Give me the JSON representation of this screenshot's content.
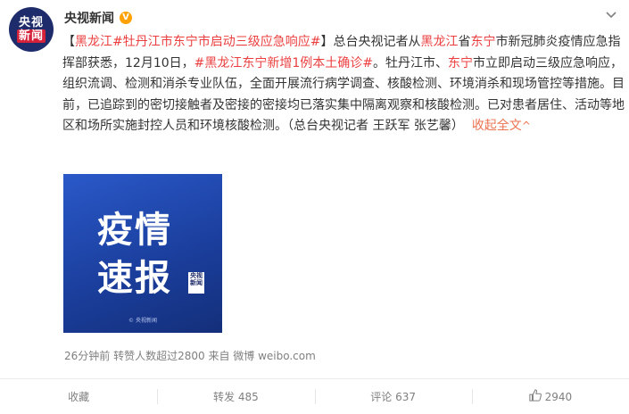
{
  "header": {
    "account_name": "央视新闻",
    "avatar_line1": "央视",
    "avatar_line2": "新闻",
    "verified_glyph": "V",
    "more_icon": "chevron-down-icon"
  },
  "post": {
    "open_bracket": "【",
    "hashtag1_part1": "黑龙江",
    "hashtag1_part2": "#牡丹江市东宁市启动三级应急响应#",
    "close_bracket": "】",
    "text1": "总台央视记者从",
    "place1": "黑龙江",
    "text2": "省",
    "place2": "东宁",
    "text3": "市新冠肺炎疫情应急指挥部获悉，12月10日，",
    "hashtag2": "#黑龙江东宁新增1例本土确诊#",
    "text4": "。牡丹江市、",
    "place3": "东宁",
    "text5": "市立即启动三级应急响应，组织流调、检测和消杀专业队伍，全面开展流行病学调查、核酸检测、环境消杀和现场管控等措施。目前，已追踪到的密切接触者及密接的密接均已落实集中隔离观察和核酸检测。已对患者居住、活动等地区和场所实施封控人员和环境核酸检测。（总台央视记者 王跃军 张艺馨）",
    "collapse_label": "收起全文",
    "collapse_arrow": "^"
  },
  "image": {
    "line1": "疫情",
    "line2": "速报",
    "logo_line1": "央视",
    "logo_line2": "新闻",
    "footer": "© 央视新闻"
  },
  "meta": {
    "text": "26分钟前 转赞人数超过2800 来自 微博 weibo.com"
  },
  "actions": {
    "favorite_label": "收藏",
    "repost_label": "转发 485",
    "comment_label": "评论 637",
    "like_count": "2940",
    "like_icon": "thumbs-up-icon"
  }
}
